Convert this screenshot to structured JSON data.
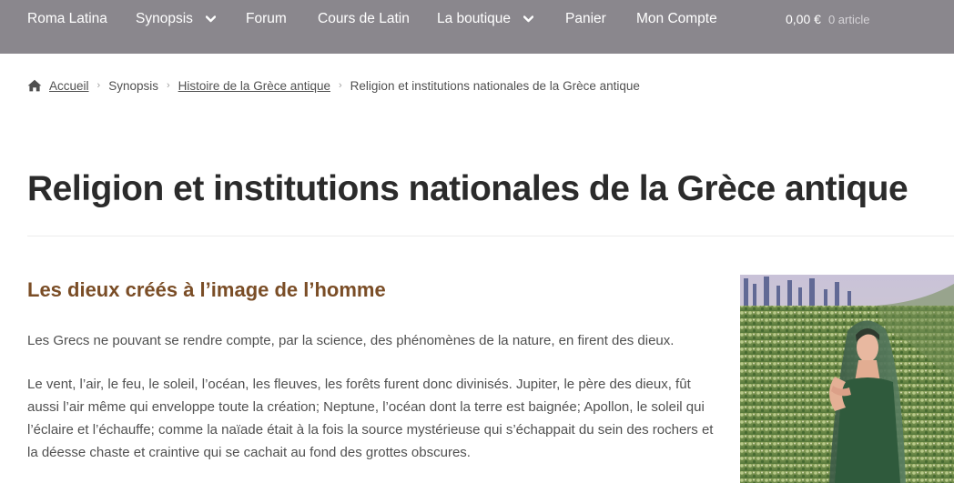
{
  "nav": {
    "items": [
      {
        "label": "Roma Latina",
        "dropdown": false
      },
      {
        "label": "Synopsis",
        "dropdown": true
      },
      {
        "label": "Forum",
        "dropdown": false
      },
      {
        "label": "Cours de Latin",
        "dropdown": false
      },
      {
        "label": "La boutique",
        "dropdown": true
      },
      {
        "label": "Panier",
        "dropdown": false
      },
      {
        "label": "Mon Compte",
        "dropdown": false
      }
    ],
    "cart": {
      "total": "0,00 €",
      "count": "0 article"
    },
    "background_color": "#8a878d"
  },
  "breadcrumb": {
    "items": [
      {
        "label": "Accueil",
        "link": true
      },
      {
        "label": "Synopsis",
        "link": false
      },
      {
        "label": "Histoire de la Grèce antique",
        "link": true
      },
      {
        "label": "Religion et institutions nationales de la Grèce antique",
        "link": false
      }
    ],
    "icon": "home-icon"
  },
  "page": {
    "title": "Religion et institutions nationales de la Grèce antique"
  },
  "section": {
    "heading": "Les dieux créés à l’image de l’homme",
    "heading_color": "#7a4d26",
    "paragraphs": [
      "Les Grecs ne pouvant se rendre compte, par la science, des phénomènes de la nature, en firent des dieux.",
      "Le vent, l’air, le feu, le soleil, l’océan, les fleuves, les forêts furent donc divinisés. Jupiter, le père des dieux, fût aussi l’air même qui enveloppe toute la création; Neptune, l’océan dont la terre est baignée; Apollon, le soleil qui l’éclaire et l’échauffe; comme la naïade était à la fois la source mystérieuse qui s’échappait du sein des rochers et la déesse chaste et craintive qui se cachait au fond des grottes obscures."
    ]
  }
}
